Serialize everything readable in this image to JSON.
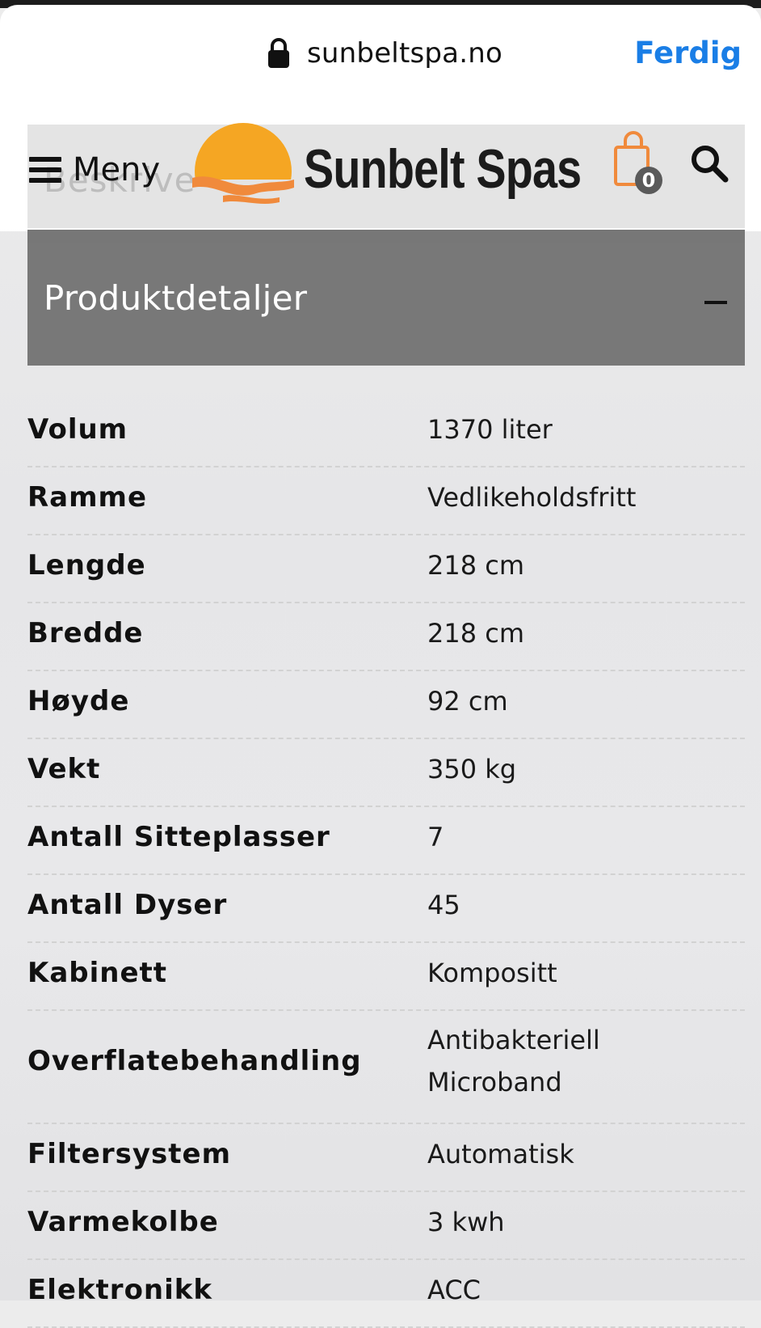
{
  "browser": {
    "url": "sunbeltspa.no",
    "done_label": "Ferdig"
  },
  "header": {
    "menu_label": "Meny",
    "brand_name": "Sunbelt Spas",
    "cart_count": "0",
    "behind_text": "Beskrive"
  },
  "accordion": {
    "title": "Produktdetaljer"
  },
  "specs": [
    {
      "label": "Volum",
      "value": "1370 liter"
    },
    {
      "label": "Ramme",
      "value": "Vedlikeholdsfritt"
    },
    {
      "label": "Lengde",
      "value": "218 cm"
    },
    {
      "label": "Bredde",
      "value": "218 cm"
    },
    {
      "label": "Høyde",
      "value": "92 cm"
    },
    {
      "label": "Vekt",
      "value": "350 kg"
    },
    {
      "label": "Antall Sitteplasser",
      "value": "7"
    },
    {
      "label": "Antall Dyser",
      "value": "45"
    },
    {
      "label": "Kabinett",
      "value": "Kompositt"
    },
    {
      "label": "Overflatebehandling",
      "value": "Antibakteriell Microband"
    },
    {
      "label": "Filtersystem",
      "value": "Automatisk"
    },
    {
      "label": "Varmekolbe",
      "value": "3 kwh"
    },
    {
      "label": "Elektronikk",
      "value": "ACC"
    }
  ],
  "colors": {
    "link_blue": "#1a7ee6",
    "accordion_gray": "#787878",
    "logo_orange": "#f5a623",
    "logo_wave": "#f08a3c"
  }
}
